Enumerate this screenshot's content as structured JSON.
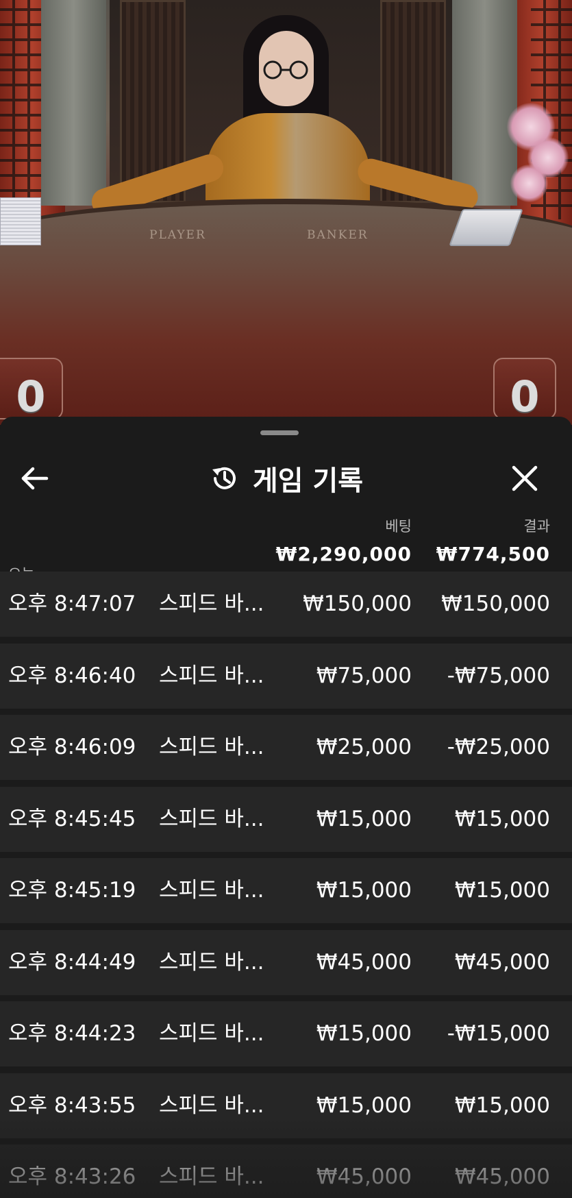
{
  "video": {
    "table_labels": {
      "player": "PLAYER",
      "banker": "BANKER"
    },
    "scores": {
      "left": "0",
      "right": "0"
    }
  },
  "panel": {
    "title": "게임 기록",
    "icons": {
      "back": "arrow-left-icon",
      "history": "history-clock-icon",
      "close": "close-x-icon"
    },
    "columns": {
      "bet": "베팅",
      "result": "결과"
    },
    "summary": {
      "date_label": "오늘",
      "total_bet": "₩2,290,000",
      "total_result": "₩774,500"
    },
    "rows": [
      {
        "time": "오후 8:47:07",
        "game": "스피드 바...",
        "bet": "₩150,000",
        "result": "₩150,000"
      },
      {
        "time": "오후 8:46:40",
        "game": "스피드 바...",
        "bet": "₩75,000",
        "result": "-₩75,000"
      },
      {
        "time": "오후 8:46:09",
        "game": "스피드 바...",
        "bet": "₩25,000",
        "result": "-₩25,000"
      },
      {
        "time": "오후 8:45:45",
        "game": "스피드 바...",
        "bet": "₩15,000",
        "result": "₩15,000"
      },
      {
        "time": "오후 8:45:19",
        "game": "스피드 바...",
        "bet": "₩15,000",
        "result": "₩15,000"
      },
      {
        "time": "오후 8:44:49",
        "game": "스피드 바...",
        "bet": "₩45,000",
        "result": "₩45,000"
      },
      {
        "time": "오후 8:44:23",
        "game": "스피드 바...",
        "bet": "₩15,000",
        "result": "-₩15,000"
      },
      {
        "time": "오후 8:43:55",
        "game": "스피드 바...",
        "bet": "₩15,000",
        "result": "₩15,000"
      },
      {
        "time": "오후 8:43:26",
        "game": "스피드 바...",
        "bet": "₩45,000",
        "result": "₩45,000"
      }
    ]
  }
}
